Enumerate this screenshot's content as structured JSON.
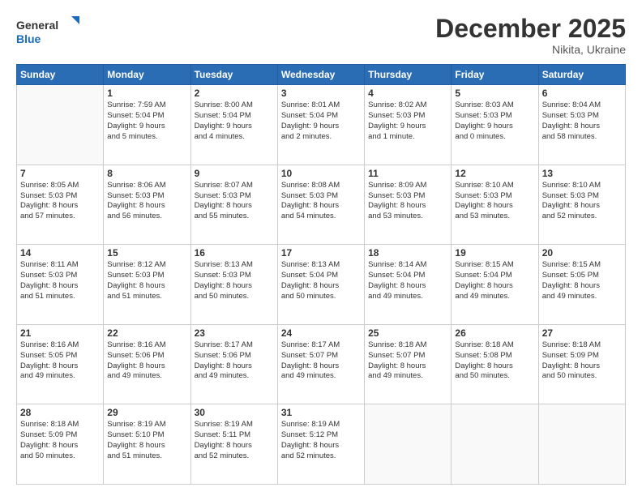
{
  "header": {
    "logo_line1": "General",
    "logo_line2": "Blue",
    "month": "December 2025",
    "location": "Nikita, Ukraine"
  },
  "days_of_week": [
    "Sunday",
    "Monday",
    "Tuesday",
    "Wednesday",
    "Thursday",
    "Friday",
    "Saturday"
  ],
  "weeks": [
    [
      {
        "num": "",
        "info": ""
      },
      {
        "num": "1",
        "info": "Sunrise: 7:59 AM\nSunset: 5:04 PM\nDaylight: 9 hours\nand 5 minutes."
      },
      {
        "num": "2",
        "info": "Sunrise: 8:00 AM\nSunset: 5:04 PM\nDaylight: 9 hours\nand 4 minutes."
      },
      {
        "num": "3",
        "info": "Sunrise: 8:01 AM\nSunset: 5:04 PM\nDaylight: 9 hours\nand 2 minutes."
      },
      {
        "num": "4",
        "info": "Sunrise: 8:02 AM\nSunset: 5:03 PM\nDaylight: 9 hours\nand 1 minute."
      },
      {
        "num": "5",
        "info": "Sunrise: 8:03 AM\nSunset: 5:03 PM\nDaylight: 9 hours\nand 0 minutes."
      },
      {
        "num": "6",
        "info": "Sunrise: 8:04 AM\nSunset: 5:03 PM\nDaylight: 8 hours\nand 58 minutes."
      }
    ],
    [
      {
        "num": "7",
        "info": "Sunrise: 8:05 AM\nSunset: 5:03 PM\nDaylight: 8 hours\nand 57 minutes."
      },
      {
        "num": "8",
        "info": "Sunrise: 8:06 AM\nSunset: 5:03 PM\nDaylight: 8 hours\nand 56 minutes."
      },
      {
        "num": "9",
        "info": "Sunrise: 8:07 AM\nSunset: 5:03 PM\nDaylight: 8 hours\nand 55 minutes."
      },
      {
        "num": "10",
        "info": "Sunrise: 8:08 AM\nSunset: 5:03 PM\nDaylight: 8 hours\nand 54 minutes."
      },
      {
        "num": "11",
        "info": "Sunrise: 8:09 AM\nSunset: 5:03 PM\nDaylight: 8 hours\nand 53 minutes."
      },
      {
        "num": "12",
        "info": "Sunrise: 8:10 AM\nSunset: 5:03 PM\nDaylight: 8 hours\nand 53 minutes."
      },
      {
        "num": "13",
        "info": "Sunrise: 8:10 AM\nSunset: 5:03 PM\nDaylight: 8 hours\nand 52 minutes."
      }
    ],
    [
      {
        "num": "14",
        "info": "Sunrise: 8:11 AM\nSunset: 5:03 PM\nDaylight: 8 hours\nand 51 minutes."
      },
      {
        "num": "15",
        "info": "Sunrise: 8:12 AM\nSunset: 5:03 PM\nDaylight: 8 hours\nand 51 minutes."
      },
      {
        "num": "16",
        "info": "Sunrise: 8:13 AM\nSunset: 5:03 PM\nDaylight: 8 hours\nand 50 minutes."
      },
      {
        "num": "17",
        "info": "Sunrise: 8:13 AM\nSunset: 5:04 PM\nDaylight: 8 hours\nand 50 minutes."
      },
      {
        "num": "18",
        "info": "Sunrise: 8:14 AM\nSunset: 5:04 PM\nDaylight: 8 hours\nand 49 minutes."
      },
      {
        "num": "19",
        "info": "Sunrise: 8:15 AM\nSunset: 5:04 PM\nDaylight: 8 hours\nand 49 minutes."
      },
      {
        "num": "20",
        "info": "Sunrise: 8:15 AM\nSunset: 5:05 PM\nDaylight: 8 hours\nand 49 minutes."
      }
    ],
    [
      {
        "num": "21",
        "info": "Sunrise: 8:16 AM\nSunset: 5:05 PM\nDaylight: 8 hours\nand 49 minutes."
      },
      {
        "num": "22",
        "info": "Sunrise: 8:16 AM\nSunset: 5:06 PM\nDaylight: 8 hours\nand 49 minutes."
      },
      {
        "num": "23",
        "info": "Sunrise: 8:17 AM\nSunset: 5:06 PM\nDaylight: 8 hours\nand 49 minutes."
      },
      {
        "num": "24",
        "info": "Sunrise: 8:17 AM\nSunset: 5:07 PM\nDaylight: 8 hours\nand 49 minutes."
      },
      {
        "num": "25",
        "info": "Sunrise: 8:18 AM\nSunset: 5:07 PM\nDaylight: 8 hours\nand 49 minutes."
      },
      {
        "num": "26",
        "info": "Sunrise: 8:18 AM\nSunset: 5:08 PM\nDaylight: 8 hours\nand 50 minutes."
      },
      {
        "num": "27",
        "info": "Sunrise: 8:18 AM\nSunset: 5:09 PM\nDaylight: 8 hours\nand 50 minutes."
      }
    ],
    [
      {
        "num": "28",
        "info": "Sunrise: 8:18 AM\nSunset: 5:09 PM\nDaylight: 8 hours\nand 50 minutes."
      },
      {
        "num": "29",
        "info": "Sunrise: 8:19 AM\nSunset: 5:10 PM\nDaylight: 8 hours\nand 51 minutes."
      },
      {
        "num": "30",
        "info": "Sunrise: 8:19 AM\nSunset: 5:11 PM\nDaylight: 8 hours\nand 52 minutes."
      },
      {
        "num": "31",
        "info": "Sunrise: 8:19 AM\nSunset: 5:12 PM\nDaylight: 8 hours\nand 52 minutes."
      },
      {
        "num": "",
        "info": ""
      },
      {
        "num": "",
        "info": ""
      },
      {
        "num": "",
        "info": ""
      }
    ]
  ]
}
